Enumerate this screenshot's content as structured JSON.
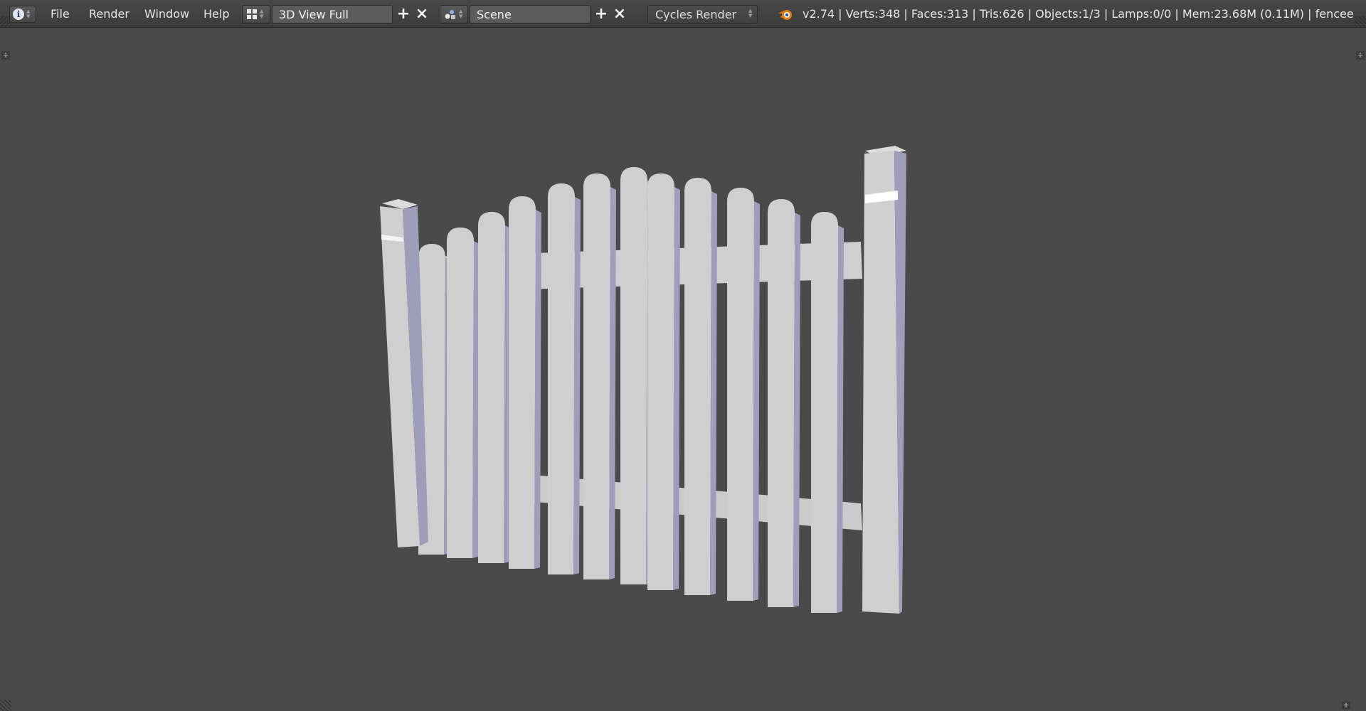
{
  "menu": {
    "file": "File",
    "render": "Render",
    "window": "Window",
    "help": "Help"
  },
  "screen_layout": {
    "name": "3D View Full",
    "icon": "screen-layout-icon"
  },
  "scene": {
    "name": "Scene",
    "icon": "scene-icon"
  },
  "render_engine": {
    "value": "Cycles Render"
  },
  "stats": {
    "text": "v2.74 | Verts:348 | Faces:313 | Tris:626 | Objects:1/3 | Lamps:0/0 | Mem:23.68M (0.11M) | fencee"
  },
  "icons": {
    "info": "info-icon",
    "add": "plus-icon",
    "close": "close-icon",
    "blender": "blender-logo-icon"
  },
  "colors": {
    "viewport_bg": "#4a4a4a",
    "header_bg": "#424242",
    "field_bg": "#5c5c5c",
    "fence_front": "#cfcfcf",
    "fence_side": "#9d9fba"
  },
  "viewport": {
    "object": "fence"
  }
}
